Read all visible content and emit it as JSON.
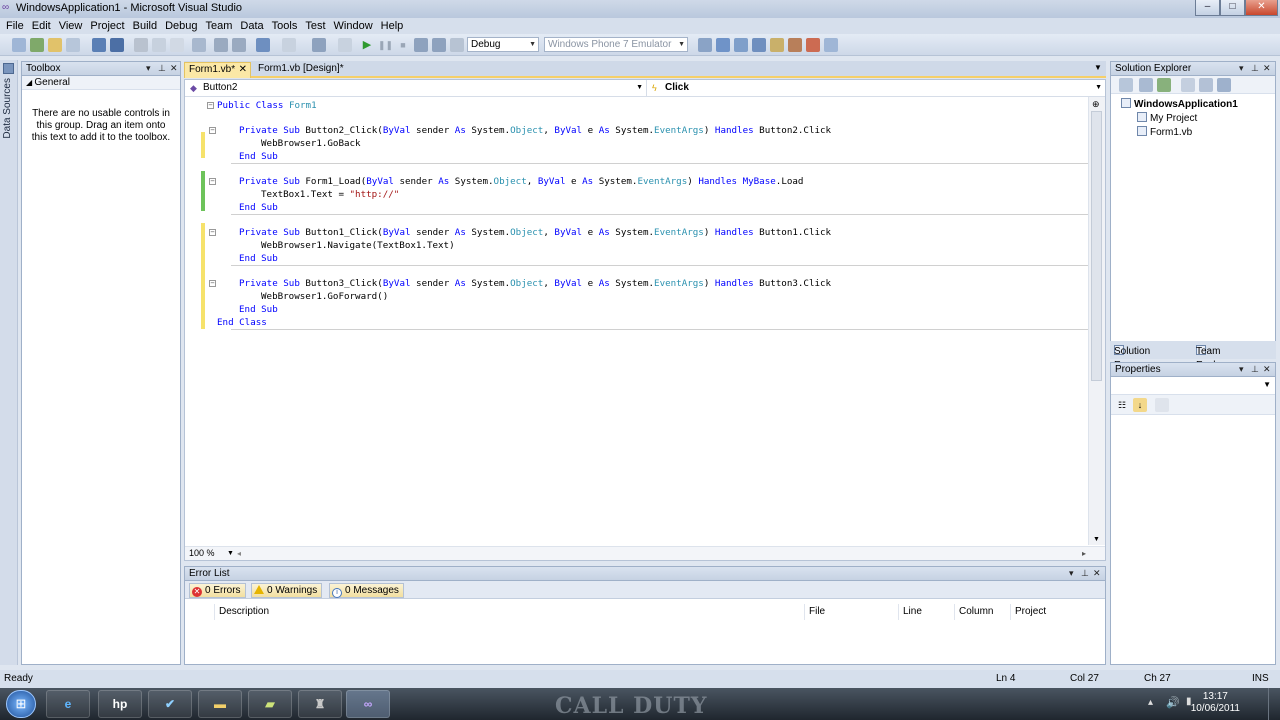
{
  "window": {
    "title": "WindowsApplication1 - Microsoft Visual Studio"
  },
  "menu": [
    "File",
    "Edit",
    "View",
    "Project",
    "Build",
    "Debug",
    "Team",
    "Data",
    "Tools",
    "Test",
    "Window",
    "Help"
  ],
  "toolbar": {
    "config": "Debug",
    "platform": "Windows Phone 7 Emulator"
  },
  "left_strip": {
    "label": "Data Sources"
  },
  "toolbox": {
    "title": "Toolbox",
    "group": "General",
    "empty_text": "There are no usable controls in this group. Drag an item onto this text to add it to the toolbox."
  },
  "editor": {
    "tabs": [
      {
        "label": "Form1.vb*",
        "active": true
      },
      {
        "label": "Form1.vb [Design]*",
        "active": false
      }
    ],
    "object_dropdown": "Button2",
    "member_dropdown": "Click",
    "zoom": "100 %",
    "code": {
      "l1": {
        "kw": "Public Class",
        "name": "Form1"
      },
      "b2_sig": {
        "a": "Private Sub",
        "b": " Button2_Click(",
        "c": "ByVal",
        "d": " sender ",
        "e": "As",
        "f": " System.",
        "g": "Object",
        "h": ", ",
        "i": "ByVal",
        "j": " e ",
        "k": "As",
        "l": " System.",
        "m": "EventArgs",
        "n": ") ",
        "o": "Handles",
        "p": " Button2.Click"
      },
      "b2_body": "WebBrowser1.GoBack",
      "end_sub": "End Sub",
      "fl_sig": {
        "a": "Private Sub",
        "b": " Form1_Load(",
        "c": "ByVal",
        "d": " sender ",
        "e": "As",
        "f": " System.",
        "g": "Object",
        "h": ", ",
        "i": "ByVal",
        "j": " e ",
        "k": "As",
        "l": " System.",
        "m": "EventArgs",
        "n": ") ",
        "o": "Handles",
        "p": " MyBase",
        "q": ".Load"
      },
      "fl_body_a": "TextBox1.Text = ",
      "fl_body_b": "\"http://\"",
      "b1_sig": {
        "a": "Private Sub",
        "b": " Button1_Click(",
        "c": "ByVal",
        "d": " sender ",
        "e": "As",
        "f": " System.",
        "g": "Object",
        "h": ", ",
        "i": "ByVal",
        "j": " e ",
        "k": "As",
        "l": " System.",
        "m": "EventArgs",
        "n": ") ",
        "o": "Handles",
        "p": " Button1.Click"
      },
      "b1_body": "WebBrowser1.Navigate(TextBox1.Text)",
      "b3_sig": {
        "a": "Private Sub",
        "b": " Button3_Click(",
        "c": "ByVal",
        "d": " sender ",
        "e": "As",
        "f": " System.",
        "g": "Object",
        "h": ", ",
        "i": "ByVal",
        "j": " e ",
        "k": "As",
        "l": " System.",
        "m": "EventArgs",
        "n": ") ",
        "o": "Handles",
        "p": " Button3.Click"
      },
      "b3_body": "WebBrowser1.GoForward()",
      "end_class": "End Class"
    }
  },
  "error_list": {
    "title": "Error List",
    "errors": "0 Errors",
    "warnings": "0 Warnings",
    "messages": "0 Messages",
    "columns": [
      "Description",
      "File",
      "Line",
      "Column",
      "Project"
    ]
  },
  "solution_explorer": {
    "title": "Solution Explorer",
    "tree": [
      "WindowsApplication1",
      "My Project",
      "Form1.vb"
    ],
    "tabs": [
      "Solution Ex...",
      "Team Explo..."
    ]
  },
  "properties": {
    "title": "Properties"
  },
  "status": {
    "ready": "Ready",
    "ln": "Ln 4",
    "col": "Col 27",
    "ch": "Ch 27",
    "mode": "INS"
  },
  "taskbar": {
    "time": "13:17",
    "date": "10/06/2011",
    "wallpaper_text": "CALL DUTY"
  },
  "colors": {
    "keyword": "#0000ff",
    "type": "#2b91af",
    "string": "#a31515",
    "active_tab": "#fbe8a6"
  }
}
